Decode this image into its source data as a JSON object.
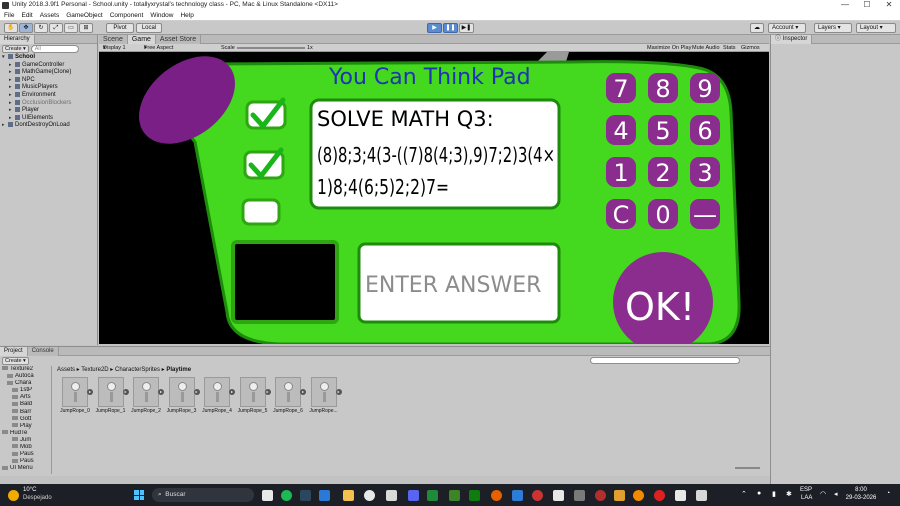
{
  "window": {
    "title": "Unity 2018.3.9f1 Personal - School.unity - totallyxrystal's technology class - PC, Mac & Linux Standalone <DX11>",
    "controls": {
      "minimize": "—",
      "maximize": "☐",
      "close": "✕"
    }
  },
  "menu": [
    "File",
    "Edit",
    "Assets",
    "GameObject",
    "Component",
    "Window",
    "Help"
  ],
  "toolbar": {
    "pivot": "Pivot",
    "local": "Local",
    "account": "Account",
    "layers": "Layers",
    "layout": "Layout",
    "play_state": "playing"
  },
  "hierarchy": {
    "tab": "Hierarchy",
    "create": "Create",
    "search_placeholder": "All",
    "items": [
      {
        "label": "School",
        "level": 0,
        "style": "bold",
        "expanded": true
      },
      {
        "label": "GameController",
        "level": 1,
        "style": "normal"
      },
      {
        "label": "MathGame(Clone)",
        "level": 1,
        "style": "normal"
      },
      {
        "label": "NPC",
        "level": 1,
        "style": "normal"
      },
      {
        "label": "MusicPlayers",
        "level": 1,
        "style": "normal"
      },
      {
        "label": "Environment",
        "level": 1,
        "style": "normal"
      },
      {
        "label": "OcclusionBlockers",
        "level": 1,
        "style": "gray"
      },
      {
        "label": "Player",
        "level": 1,
        "style": "normal"
      },
      {
        "label": "UIElements",
        "level": 1,
        "style": "normal"
      },
      {
        "label": "DontDestroyOnLoad",
        "level": 0,
        "style": "normal"
      }
    ]
  },
  "game_view": {
    "tabs": [
      "Scene",
      "Game",
      "Asset Store"
    ],
    "active_tab": "Game",
    "display": "Display 1",
    "aspect": "Free Aspect",
    "scale_label": "Scale",
    "scale_value": "1x",
    "options": [
      "Maximize On Play",
      "Mute Audio",
      "Stats",
      "Gizmos"
    ],
    "pad": {
      "title": "You Can Think Pad",
      "question": "SOLVE MATH Q3:",
      "garbled_line1": "(8)8;3;4(3-((7)8(4;3),9)7;2)3(4×",
      "garbled_line2": "1)8;4(6;5)2;2)7=",
      "answer_placeholder": "ENTER ANSWER",
      "checks": [
        true,
        true,
        false
      ],
      "keys": [
        "7",
        "8",
        "9",
        "4",
        "5",
        "6",
        "1",
        "2",
        "3",
        "C",
        "0",
        "—"
      ],
      "ok_label": "OK!"
    }
  },
  "inspector": {
    "tab": "Inspector"
  },
  "project": {
    "tabs": [
      "Project",
      "Console"
    ],
    "create": "Create",
    "breadcrumb": [
      "Assets",
      "Texture2D",
      "CharacterSprites",
      "Playtime"
    ],
    "tree": [
      {
        "label": "Texture2",
        "level": 0
      },
      {
        "label": "Autoca",
        "level": 1
      },
      {
        "label": "Chara",
        "level": 1
      },
      {
        "label": "1stP",
        "level": 2
      },
      {
        "label": "Arts",
        "level": 2
      },
      {
        "label": "Bald",
        "level": 2
      },
      {
        "label": "Barr",
        "level": 2
      },
      {
        "label": "Gott",
        "level": 2
      },
      {
        "label": "Play",
        "level": 2
      },
      {
        "label": "HudTe",
        "level": 0
      },
      {
        "label": "Jum",
        "level": 2
      },
      {
        "label": "Mob",
        "level": 2
      },
      {
        "label": "Paus",
        "level": 2
      },
      {
        "label": "Paus",
        "level": 2
      },
      {
        "label": "UI Menu",
        "level": 0
      }
    ],
    "assets": [
      "JumpRope_0",
      "JumpRope_1",
      "JumpRope_2",
      "JumpRope_3",
      "JumpRope_4",
      "JumpRope_5",
      "JumpRope_6",
      "JumpRope..."
    ]
  },
  "taskbar": {
    "weather_temp": "10°C",
    "weather_desc": "Despejado",
    "search_placeholder": "Buscar",
    "lang": "ESP",
    "lang_sub": "LAA",
    "time": "8:00",
    "date": "29-03-2026"
  },
  "colors": {
    "pad_green": "#44d81e",
    "pad_dark_green": "#1d8c0c",
    "key_purple": "#8a2d8e",
    "title_blue": "#1e34b5"
  }
}
